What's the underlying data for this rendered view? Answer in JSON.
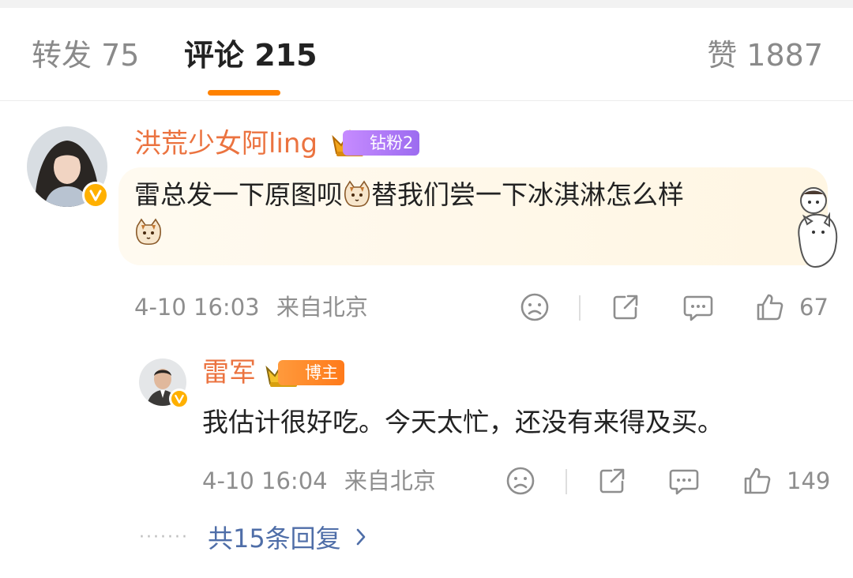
{
  "tabs": {
    "repost": "转发 75",
    "comment": "评论 215",
    "like": "赞 1887"
  },
  "comment": {
    "username": "洪荒少女阿ling",
    "fan_badge": "钻粉2",
    "text_line1_a": "雷总发一下原图呗",
    "text_line1_b": "替我们尝一下冰淇淋怎么样",
    "time": "4-10 16:03",
    "location": "来自北京",
    "likes": "67"
  },
  "reply": {
    "username": "雷军",
    "role_badge": "博主",
    "text": "我估计很好吃。今天太忙，还没有来得及买。",
    "time": "4-10 16:04",
    "location": "来自北京",
    "likes": "149"
  },
  "more_replies": {
    "label": "共15条回复"
  },
  "colors": {
    "accent": "#ff8200",
    "username": "#eb7340",
    "link": "#4f6ea8",
    "verified": "#ffb000"
  },
  "icons": [
    "dislike-face-icon",
    "share-icon",
    "comment-icon",
    "thumbs-up-icon",
    "chevron-right-icon",
    "cat-emoji-icon",
    "crown-icon"
  ]
}
